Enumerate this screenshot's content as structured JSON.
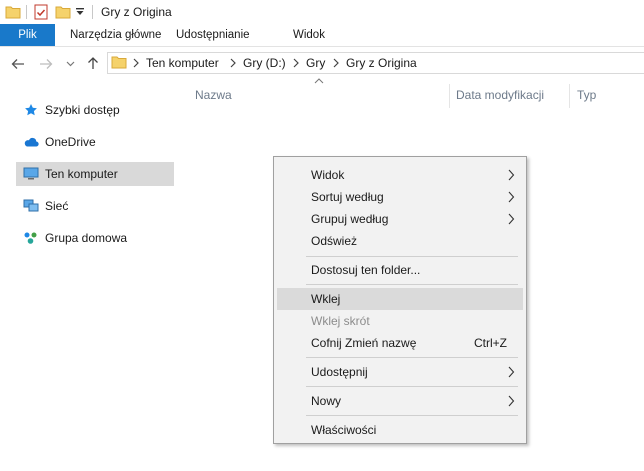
{
  "window": {
    "title": "Gry z Origina"
  },
  "quick_access_toolbar": {
    "icons": [
      "folder-icon",
      "properties-check-icon",
      "new-folder-icon",
      "customize-dropdown-icon"
    ]
  },
  "ribbon": {
    "tabs": [
      {
        "label": "Plik",
        "active": true
      },
      {
        "label": "Narzędzia główne"
      },
      {
        "label": "Udostępnianie"
      },
      {
        "label": "Widok"
      }
    ]
  },
  "address_bar": {
    "breadcrumb": [
      "Ten komputer",
      "Gry (D:)",
      "Gry",
      "Gry z Origina"
    ]
  },
  "columns": [
    "Nazwa",
    "Data modyfikacji",
    "Typ"
  ],
  "sidebar": {
    "items": [
      {
        "label": "Szybki dostęp",
        "icon": "star-icon"
      },
      {
        "label": "OneDrive",
        "icon": "cloud-icon"
      },
      {
        "label": "Ten komputer",
        "icon": "computer-icon",
        "selected": true
      },
      {
        "label": "Sieć",
        "icon": "network-icon"
      },
      {
        "label": "Grupa domowa",
        "icon": "homegroup-icon"
      }
    ]
  },
  "context_menu": {
    "items": [
      {
        "label": "Widok",
        "submenu": true
      },
      {
        "label": "Sortuj według",
        "submenu": true
      },
      {
        "label": "Grupuj według",
        "submenu": true
      },
      {
        "label": "Odśwież"
      },
      {
        "label": "Dostosuj ten folder..."
      },
      {
        "label": "Wklej",
        "highlighted": true
      },
      {
        "label": "Wklej skrót",
        "disabled": true
      },
      {
        "label": "Cofnij Zmień nazwę",
        "shortcut": "Ctrl+Z"
      },
      {
        "label": "Udostępnij",
        "submenu": true
      },
      {
        "label": "Nowy",
        "submenu": true
      },
      {
        "label": "Właściwości"
      }
    ]
  },
  "colors": {
    "accent": "#1979ca",
    "selection": "#d9d9d9",
    "menu_bg": "#f2f2f2"
  }
}
